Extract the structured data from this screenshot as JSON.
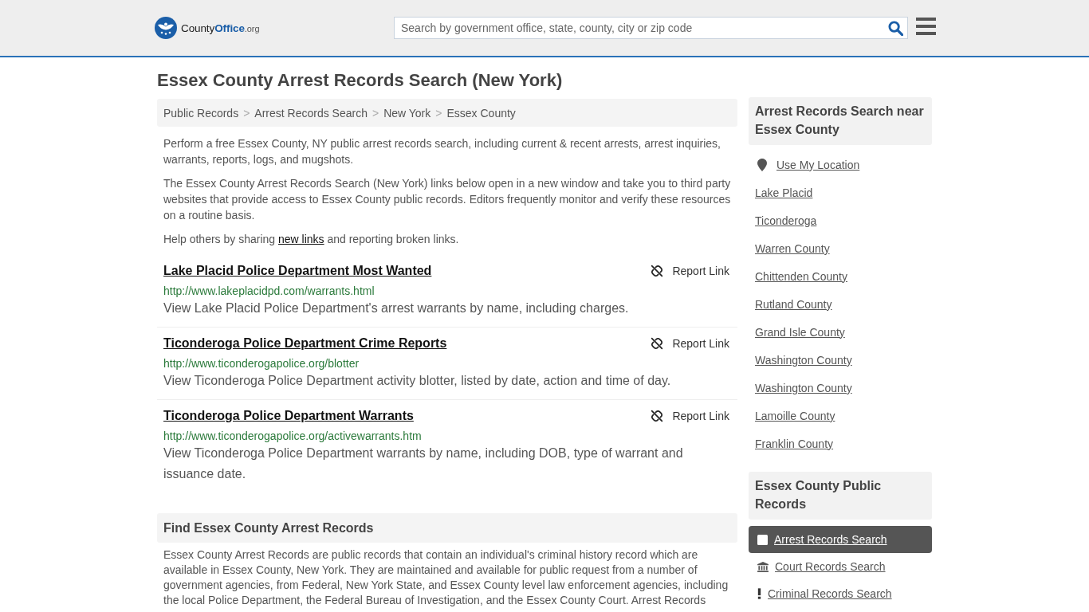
{
  "header": {
    "logo": {
      "prefix": "County",
      "highlight": "Office",
      "suffix": ".org"
    },
    "search": {
      "placeholder": "Search by government office, state, county, city or zip code"
    }
  },
  "page_title": "Essex County Arrest Records Search (New York)",
  "breadcrumb": {
    "separator": ">",
    "items": [
      "Public Records",
      "Arrest Records Search",
      "New York",
      "Essex County"
    ]
  },
  "intro": {
    "paragraphs": [
      "Perform a free Essex County, NY public arrest records search, including current & recent arrests, arrest inquiries, warrants, reports, logs, and mugshots.",
      "The Essex County Arrest Records Search (New York) links below open in a new window and take you to third party websites that provide access to Essex County public records. Editors frequently monitor and verify these resources on a routine basis."
    ],
    "help": {
      "before": "Help others by sharing ",
      "link": "new links",
      "after": " and reporting broken links."
    }
  },
  "links": [
    {
      "title": "Lake Placid Police Department Most Wanted",
      "url": "http://www.lakeplacidpd.com/warrants.html",
      "description": "View Lake Placid Police Department's arrest warrants by name, including charges.",
      "report": "Report Link"
    },
    {
      "title": "Ticonderoga Police Department Crime Reports",
      "url": "http://www.ticonderogapolice.org/blotter",
      "description": "View Ticonderoga Police Department activity blotter, listed by date, action and time of day.",
      "report": "Report Link"
    },
    {
      "title": "Ticonderoga Police Department Warrants",
      "url": "http://www.ticonderogapolice.org/activewarrants.htm",
      "description": "View Ticonderoga Police Department warrants by name, including DOB, type of warrant and issuance date.",
      "report": "Report Link"
    }
  ],
  "find_section": {
    "heading": "Find Essex County Arrest Records",
    "text": "Essex County Arrest Records are public records that contain an individual's criminal history record which are available in Essex County, New York. They are maintained and available for public request from a number of government agencies, from Federal, New York State, and Essex County level law enforcement agencies, including the local Police Department, the Federal Bureau of Investigation, and the Essex County Court. Arrest Records"
  },
  "sidebar": {
    "nearby": {
      "heading": "Arrest Records Search near Essex County",
      "location_link": "Use My Location",
      "items": [
        "Lake Placid",
        "Ticonderoga",
        "Warren County",
        "Chittenden County",
        "Rutland County",
        "Grand Isle County",
        "Washington County",
        "Washington County",
        "Lamoille County",
        "Franklin County"
      ]
    },
    "public_records": {
      "heading": "Essex County Public Records",
      "items": [
        {
          "label": "Arrest Records Search",
          "selected": true
        },
        {
          "label": "Court Records Search",
          "selected": false
        },
        {
          "label": "Criminal Records Search",
          "selected": false
        }
      ]
    }
  }
}
